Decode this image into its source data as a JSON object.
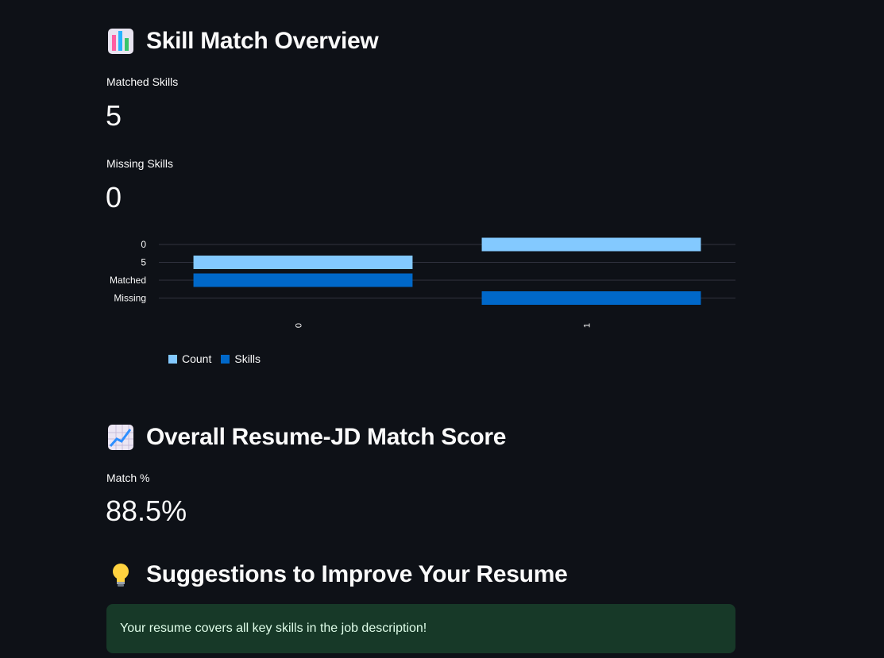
{
  "sections": {
    "skill_overview": {
      "title": "Skill Match Overview",
      "icon": "bar-chart-icon"
    },
    "match_score": {
      "title": "Overall Resume-JD Match Score",
      "icon": "chart-increasing-icon"
    },
    "suggestions": {
      "title": "Suggestions to Improve Your Resume",
      "icon": "light-bulb-icon",
      "message": "Your resume covers all key skills in the job description!"
    }
  },
  "metrics": {
    "matched": {
      "label": "Matched Skills",
      "value": "5"
    },
    "missing": {
      "label": "Missing Skills",
      "value": "0"
    },
    "match_pct": {
      "label": "Match %",
      "value": "88.5%"
    }
  },
  "colors": {
    "background": "#0e1117",
    "count_series": "#83c9ff",
    "skills_series": "#0068c9",
    "success_bg": "#173928",
    "success_text": "#dffde9"
  },
  "chart_data": {
    "type": "bar",
    "orientation": "horizontal",
    "y_categories": [
      "0",
      "5",
      "Matched",
      "Missing"
    ],
    "x_categories": [
      "0",
      "1"
    ],
    "series": [
      {
        "name": "Count",
        "color": "#83c9ff",
        "points": [
          {
            "x": "0",
            "y": "5"
          },
          {
            "x": "1",
            "y": "0"
          }
        ]
      },
      {
        "name": "Skills",
        "color": "#0068c9",
        "points": [
          {
            "x": "0",
            "y": "Matched"
          },
          {
            "x": "1",
            "y": "Missing"
          }
        ]
      }
    ],
    "legend": [
      "Count",
      "Skills"
    ],
    "legend_position": "bottom-left",
    "grid": true,
    "title": "",
    "xlabel": "",
    "ylabel": ""
  }
}
